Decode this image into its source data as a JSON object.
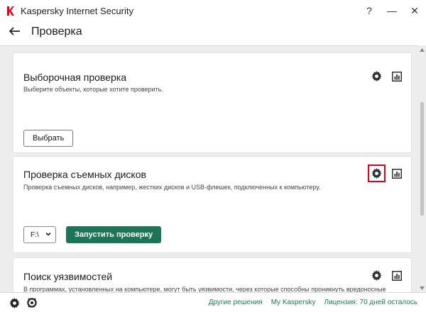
{
  "window": {
    "title": "Kaspersky Internet Security",
    "help": "?",
    "minimize": "—",
    "close": "✕"
  },
  "header": {
    "title": "Проверка"
  },
  "cards": [
    {
      "title": "Выборочная проверка",
      "description": "Выберите объекты, которые хотите проверить.",
      "button": "Выбрать"
    },
    {
      "title": "Проверка съемных дисков",
      "description": "Проверка съемных дисков, например, жестких дисков и USB-флешек, подключенных к компьютеру.",
      "drive": "F:\\",
      "button": "Запустить проверку"
    },
    {
      "title": "Поиск уязвимостей",
      "description": "В программах, установленных на компьютере, могут быть уязвимости, через которые способны проникнуть вредоносные"
    }
  ],
  "footer": {
    "links": [
      "Другие решения",
      "My Kaspersky",
      "Лицензия: 70 дней осталось"
    ]
  },
  "colors": {
    "accent_green": "#1b7556",
    "link_green": "#1a7d52",
    "highlight_red": "#e0001b",
    "brand_red": "#e2001a"
  }
}
